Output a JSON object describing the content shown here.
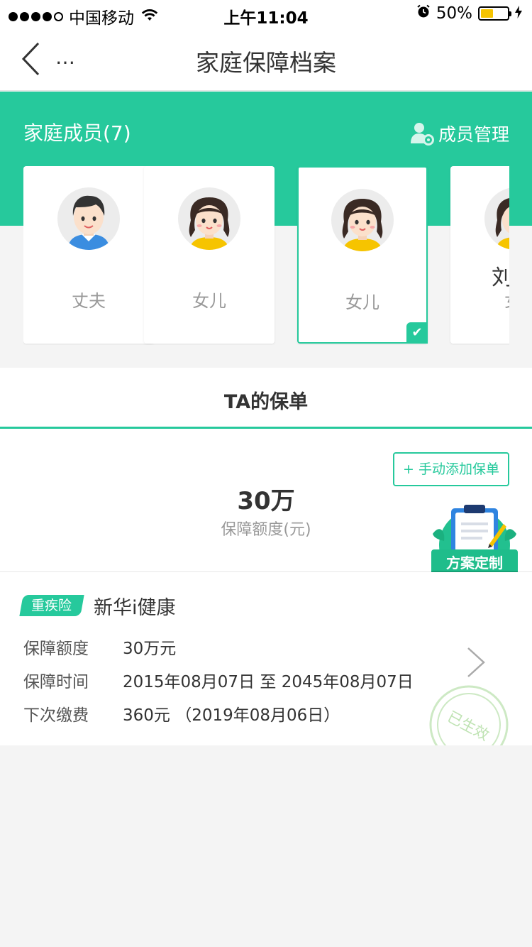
{
  "status_bar": {
    "carrier": "中国移动",
    "time": "上午11:04",
    "battery": "50%"
  },
  "nav": {
    "more": "…",
    "title": "家庭保障档案"
  },
  "members": {
    "title": "家庭成员(7)",
    "manage_label": "成员管理",
    "cards": [
      {
        "name": "",
        "relation": "丈夫",
        "selected": false
      },
      {
        "name": "",
        "relation": "女儿",
        "selected": false
      },
      {
        "name": "",
        "relation": "女儿",
        "selected": true
      },
      {
        "name": "刘",
        "relation": "女",
        "selected": false
      }
    ]
  },
  "tab": {
    "label": "TA的保单"
  },
  "summary": {
    "add_button": "+ 手动添加保单",
    "amount": "30万",
    "amount_label": "保障额度(元)",
    "plan_badge": "方案定制"
  },
  "policy": {
    "tag": "重疾险",
    "name": "新华i健康",
    "rows": [
      {
        "label": "保障额度",
        "value": "30万元"
      },
      {
        "label": "保障时间",
        "value": "2015年08月07日 至 2045年08月07日"
      },
      {
        "label": "下次缴费",
        "value": "360元 （2019年08月06日）"
      }
    ],
    "stamp": "已生效"
  },
  "colors": {
    "accent": "#26c99c",
    "background": "#f4f4f4"
  }
}
